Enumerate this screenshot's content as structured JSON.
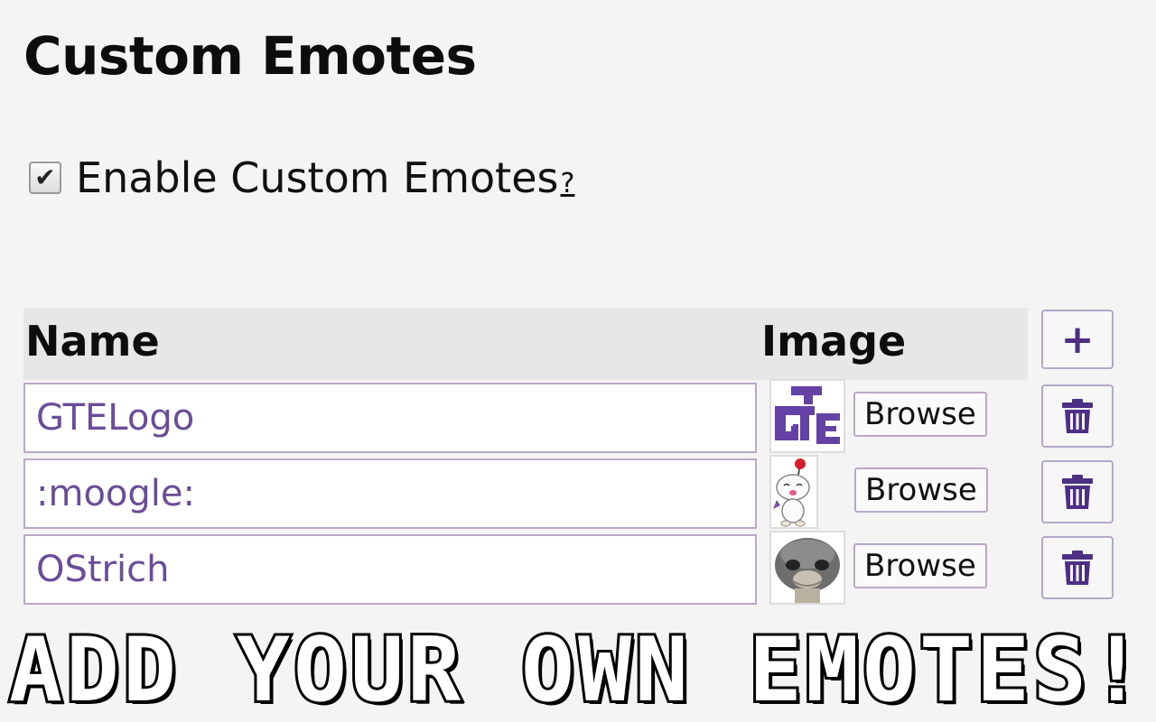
{
  "page": {
    "title": "Custom Emotes"
  },
  "enable": {
    "label": "Enable Custom Emotes",
    "help": "?",
    "checked": true
  },
  "table": {
    "headers": {
      "name": "Name",
      "image": "Image"
    },
    "add_label": "+",
    "browse_label": "Browse",
    "rows": [
      {
        "name": "GTELogo",
        "image_icon": "gte-logo-icon"
      },
      {
        "name": ":moogle:",
        "image_icon": "moogle-icon"
      },
      {
        "name": "OStrich",
        "image_icon": "ostrich-icon"
      }
    ]
  },
  "banner": {
    "text": "ADD YOUR OWN EMOTES!"
  },
  "colors": {
    "accent": "#4e2f86",
    "input_text": "#6a4c98",
    "border": "#b9a8c8",
    "background": "#f4f4f4"
  }
}
